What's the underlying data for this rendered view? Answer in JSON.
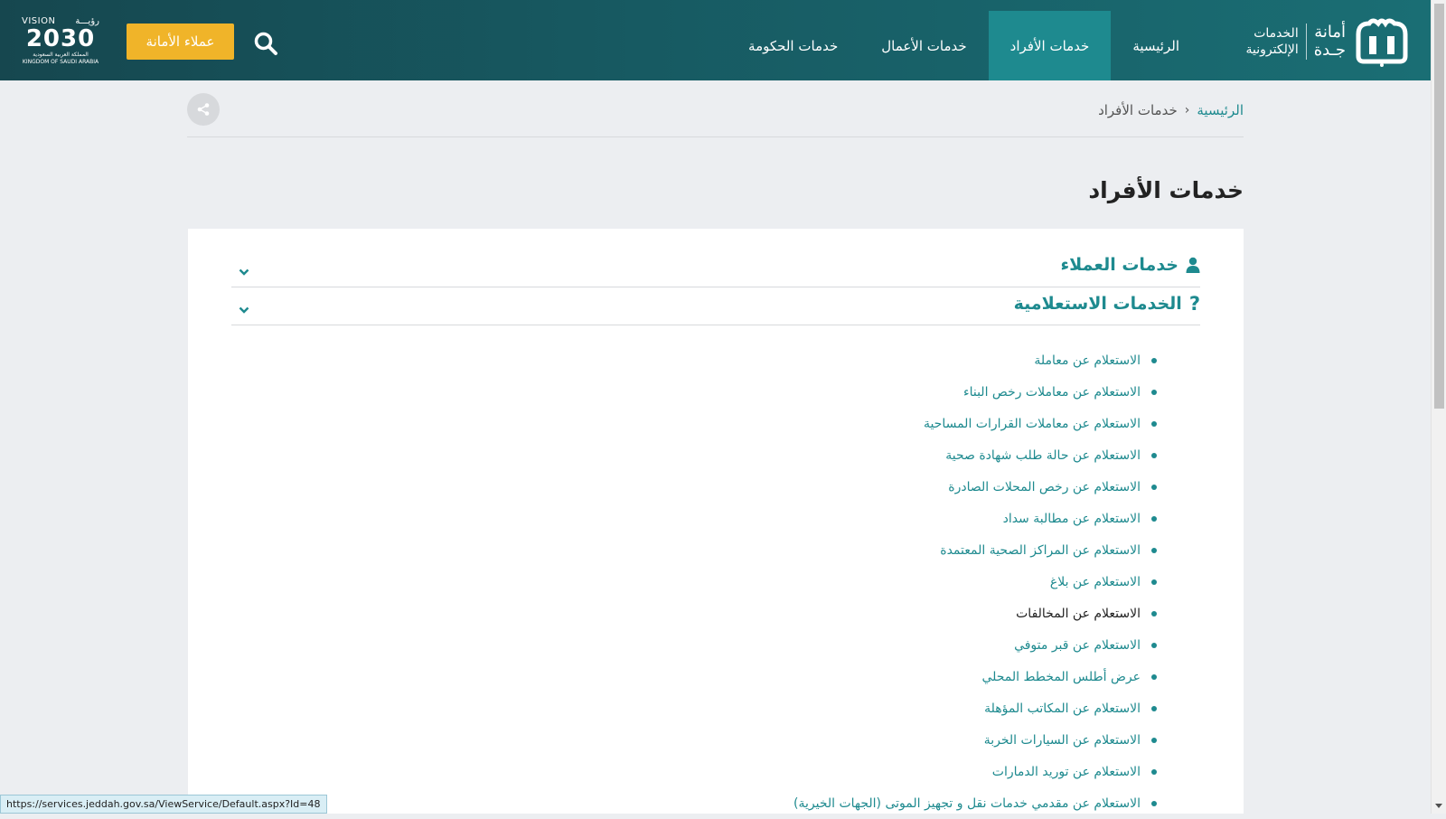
{
  "brand": {
    "name_line1": "أمانة",
    "name_line2": "جـدة",
    "sub_line1": "الخدمات",
    "sub_line2": "الإلكترونية"
  },
  "nav": {
    "items": [
      {
        "label": "الرئيسية",
        "active": false
      },
      {
        "label": "خدمات الأفراد",
        "active": true
      },
      {
        "label": "خدمات الأعمال",
        "active": false
      },
      {
        "label": "خدمات الحكومة",
        "active": false
      }
    ]
  },
  "header": {
    "clients_button": "عملاء الأمانة",
    "vision_top_en": "VISION",
    "vision_top_ar": "رؤيـــة",
    "vision_year": "2030",
    "vision_sub_ar": "المملكة العربية السعودية",
    "vision_sub_en": "KINGDOM OF SAUDI ARABIA"
  },
  "breadcrumb": {
    "home": "الرئيسية",
    "current": "خدمات الأفراد"
  },
  "page_title": "خدمات الأفراد",
  "accordion": {
    "customer_services": "خدمات العملاء",
    "inquiry_services": "الخدمات الاستعلامية"
  },
  "services": [
    "الاستعلام عن معاملة",
    "الاستعلام عن معاملات رخص البناء",
    "الاستعلام عن معاملات القرارات المساحية",
    "الاستعلام عن حالة طلب شهادة صحية",
    "الاستعلام عن رخص المحلات الصادرة",
    "الاستعلام عن مطالبة سداد",
    "الاستعلام عن المراكز الصحية المعتمدة",
    "الاستعلام عن بلاغ",
    "الاستعلام عن المخالفات",
    "الاستعلام عن قبر متوفي",
    "عرض أطلس المخطط المحلي",
    "الاستعلام عن المكاتب المؤهلة",
    "الاستعلام عن السيارات الخربة",
    "الاستعلام عن توريد الدمارات",
    "الاستعلام عن مقدمي خدمات نقل و تجهيز الموتى (الجهات الخيرية)"
  ],
  "hovered_service_index": 8,
  "status_url": "https://services.jeddah.gov.sa/ViewService/Default.aspx?Id=48",
  "colors": {
    "header_dark": "#16474f",
    "header_light": "#1a6e74",
    "nav_active": "#1e8a8f",
    "accent_teal": "#1e8a8f",
    "clients_button": "#f0b429",
    "page_bg": "#eceef1"
  }
}
